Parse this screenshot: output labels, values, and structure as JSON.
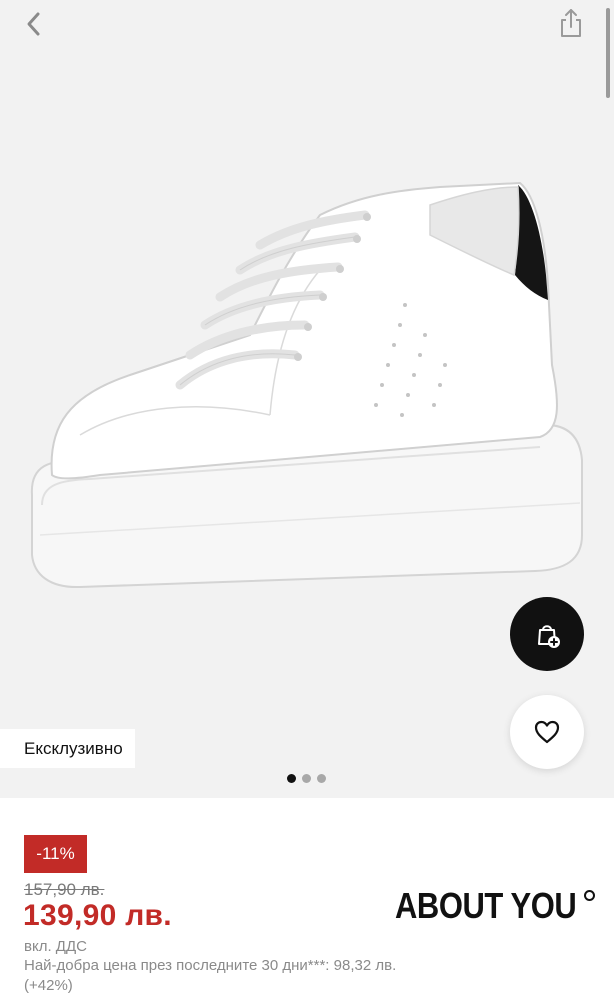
{
  "gallery": {
    "badge_label": "Ексклузивно",
    "image_count": 3,
    "active_image": 1
  },
  "icons": {
    "back": "chevron-left-icon",
    "share": "share-icon",
    "add_to_cart": "shopping-bag-plus-icon",
    "wishlist": "heart-icon"
  },
  "pricing": {
    "discount_label": "-11%",
    "old_price": "157,90 лв.",
    "new_price": "139,90 лв.",
    "vat_note": "вкл. ДДС",
    "best_price_note": "Най-добра цена през последните 30 дни***: 98,32 лв. (+42%)"
  },
  "brand": {
    "logo_text": "ABOUT YOU"
  },
  "colors": {
    "sale_red": "#c22b27",
    "dark": "#111111",
    "gallery_bg": "#f2f2f2"
  }
}
